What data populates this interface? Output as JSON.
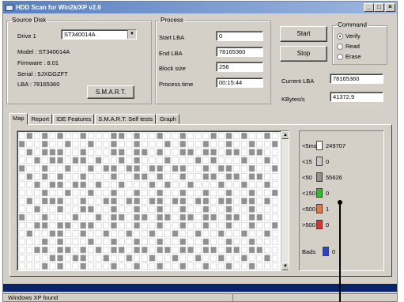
{
  "window": {
    "title": "HDD Scan for Win2k/XP  v2.6",
    "minimize": "_",
    "maximize": "□",
    "close": "×"
  },
  "source_disk": {
    "legend": "Source Disk",
    "drive_label": "Drive 1",
    "drive_value": "ST340014A",
    "model": "Model : ST340014A",
    "firmware": "Firmware : 8.01",
    "serial": "Serial : 5JXGGZFT",
    "lba": "LBA : 78165360",
    "smart_button": "S.M.A.R.T."
  },
  "process": {
    "legend": "Process",
    "start_lba_label": "Start LBA",
    "start_lba_value": "0",
    "end_lba_label": "End LBA",
    "end_lba_value": "78165360",
    "block_size_label": "Block size",
    "block_size_value": "256",
    "process_time_label": "Process time",
    "process_time_value": "00:15:44",
    "start_button": "Start",
    "stop_button": "Stop",
    "current_lba_label": "Current LBA",
    "current_lba_value": "78165360",
    "kbytes_label": "KBytes/s",
    "kbytes_value": "41372,9"
  },
  "command": {
    "legend": "Command",
    "options": [
      "Verify",
      "Read",
      "Erase"
    ],
    "selected": "Verify"
  },
  "tabs": [
    "Map",
    "Report",
    "IDE Features",
    "S.M.A.R.T. Self tests",
    "Graph"
  ],
  "active_tab": "Map",
  "legend": [
    {
      "name": "<5ms",
      "value": "249707",
      "color": "#ffffff"
    },
    {
      "name": "<15",
      "value": "0",
      "color": "#c8c8c8"
    },
    {
      "name": "<50",
      "value": "55626",
      "color": "#909090"
    },
    {
      "name": "<150",
      "value": "0",
      "color": "#22c522"
    },
    {
      "name": "<500",
      "value": "1",
      "color": "#e87840"
    },
    {
      "name": ">500",
      "value": "0",
      "color": "#e83020"
    },
    {
      "name": "Bads",
      "value": "0",
      "color": "#2040e0"
    }
  ],
  "map": {
    "block_color": "#909090",
    "empty_color": "#ffffff",
    "grid_color": "#c8c8c8"
  },
  "status": {
    "message": "Windows XP found"
  }
}
